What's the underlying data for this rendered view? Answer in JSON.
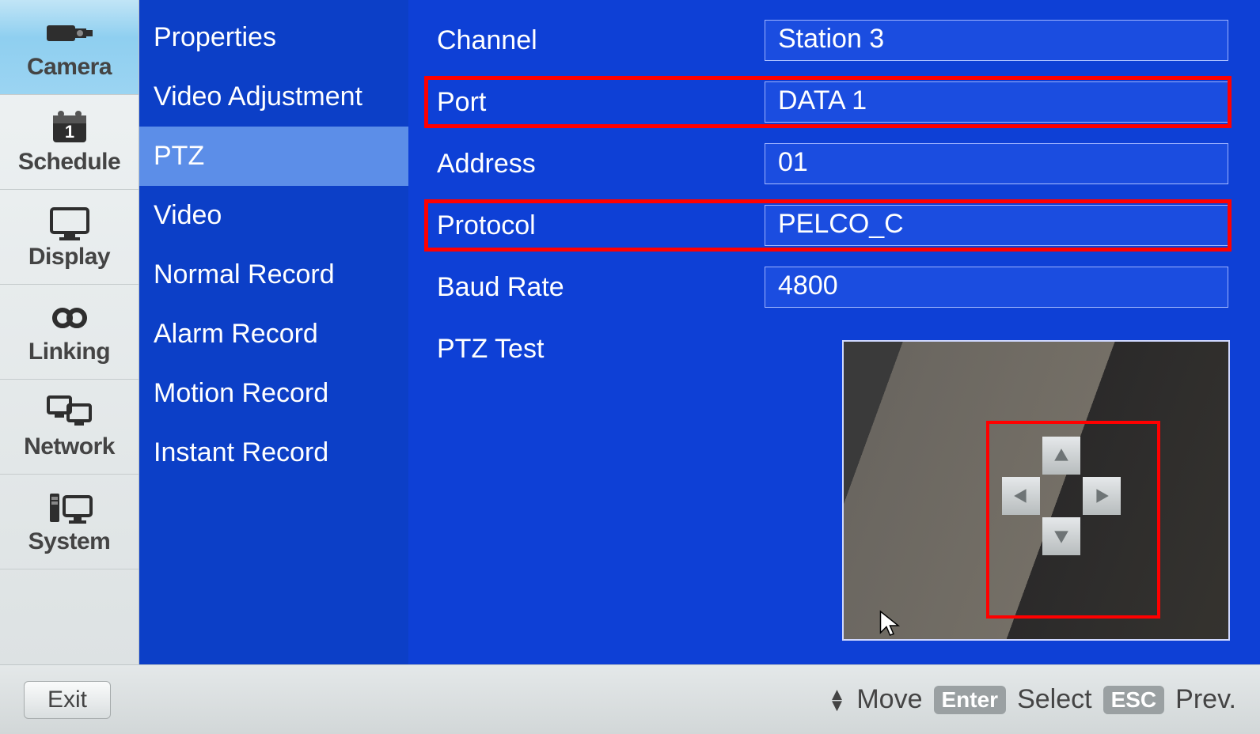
{
  "sidebar": {
    "items": [
      {
        "label": "Camera"
      },
      {
        "label": "Schedule"
      },
      {
        "label": "Display"
      },
      {
        "label": "Linking"
      },
      {
        "label": "Network"
      },
      {
        "label": "System"
      }
    ]
  },
  "submenu": {
    "items": [
      {
        "label": "Properties"
      },
      {
        "label": "Video Adjustment"
      },
      {
        "label": "PTZ"
      },
      {
        "label": "Video"
      },
      {
        "label": "Normal Record"
      },
      {
        "label": "Alarm Record"
      },
      {
        "label": "Motion Record"
      },
      {
        "label": "Instant Record"
      }
    ],
    "selected_index": 2
  },
  "form": {
    "channel": {
      "label": "Channel",
      "value": "Station  3"
    },
    "port": {
      "label": "Port",
      "value": "DATA 1"
    },
    "address": {
      "label": "Address",
      "value": "01"
    },
    "protocol": {
      "label": "Protocol",
      "value": "PELCO_C"
    },
    "baud": {
      "label": "Baud Rate",
      "value": "4800"
    },
    "ptztest": {
      "label": "PTZ Test"
    }
  },
  "footer": {
    "exit": "Exit",
    "move": "Move",
    "enter_key": "Enter",
    "select": "Select",
    "esc_key": "ESC",
    "prev": "Prev."
  }
}
